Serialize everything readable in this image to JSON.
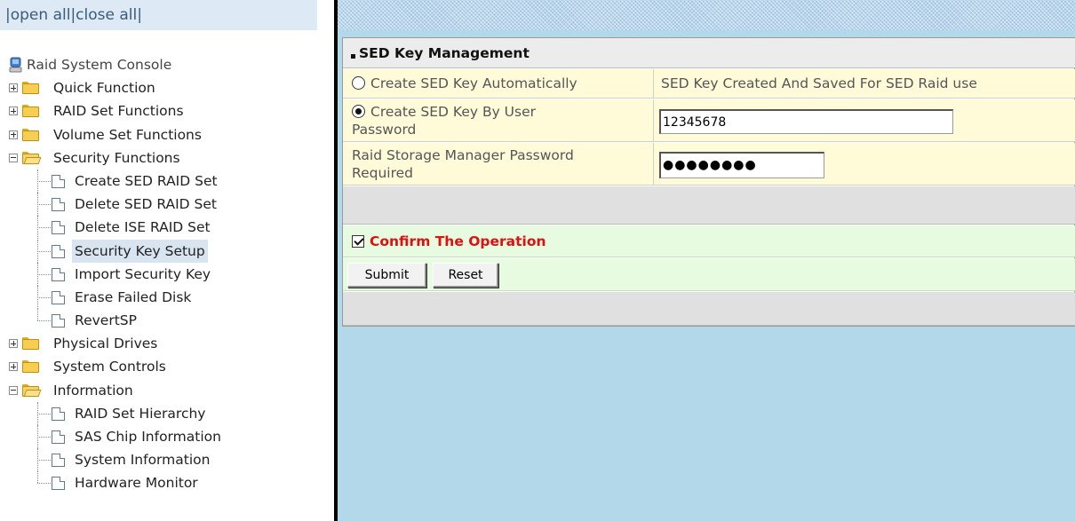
{
  "toplinks": {
    "sep1": "|",
    "open_all": "open all",
    "sep2": "|",
    "close_all": "close all",
    "sep3": "|"
  },
  "tree": {
    "root": "Raid System Console",
    "quick": "Quick Function",
    "raidset": "RAID Set Functions",
    "volumeset": "Volume Set Functions",
    "security": "Security Functions",
    "security_items": [
      "Create SED RAID Set",
      "Delete SED RAID Set",
      "Delete ISE RAID Set",
      "Security Key Setup",
      "Import Security Key",
      "Erase Failed Disk",
      "RevertSP"
    ],
    "physical": "Physical Drives",
    "syscontrols": "System Controls",
    "information": "Information",
    "info_items": [
      "RAID Set Hierarchy",
      "SAS Chip Information",
      "System Information",
      "Hardware Monitor"
    ]
  },
  "panel": {
    "title": "SED Key Management",
    "opt_auto": "Create SED Key Automatically",
    "opt_auto_desc": "SED Key Created And Saved For SED Raid use",
    "opt_user_line1": "Create SED Key By User",
    "opt_user_line2": "Password",
    "user_password_value": "12345678",
    "mgr_label_line1": "Raid Storage Manager Password",
    "mgr_label_line2": "Required",
    "mgr_password_value": "●●●●●●●●",
    "confirm": "Confirm The Operation",
    "submit": "Submit",
    "reset": "Reset"
  }
}
